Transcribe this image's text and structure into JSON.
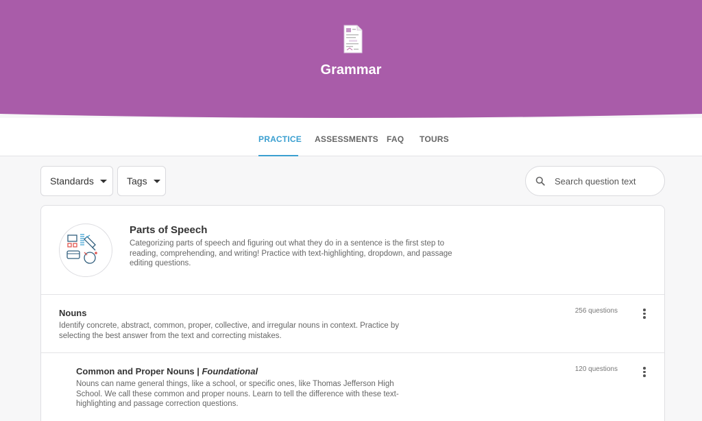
{
  "colors": {
    "hero_bg": "#a95ca9",
    "accent": "#3a9fd0"
  },
  "hero": {
    "icon": "grammar-document-icon",
    "title": "Grammar"
  },
  "tabs": [
    {
      "label": "PRACTICE",
      "active": true
    },
    {
      "label": "ASSESSMENTS",
      "active": false
    },
    {
      "label": "FAQ",
      "active": false
    },
    {
      "label": "TOURS",
      "active": false
    }
  ],
  "filters": {
    "standards_label": "Standards",
    "tags_label": "Tags"
  },
  "search": {
    "placeholder": "Search question text",
    "value": "",
    "icon": "search-icon"
  },
  "topic": {
    "icon": "parts-of-speech-illustration",
    "title": "Parts of Speech",
    "description": "Categorizing parts of speech and figuring out what they do in a sentence is the first step to reading, comprehending, and writing! Practice with text-highlighting, dropdown, and passage editing questions."
  },
  "skills": [
    {
      "title": "Nouns",
      "level": "",
      "description": "Identify concrete, abstract, common, proper, collective, and irregular nouns in context. Practice by selecting the best answer from the text and correcting mistakes.",
      "count": "256 questions"
    },
    {
      "title": "Common and Proper Nouns | ",
      "level": "Foundational",
      "description": "Nouns can name general things, like a school, or specific ones, like Thomas Jefferson High School. We call these common and proper nouns. Learn to tell the difference with these text-highlighting and passage correction questions.",
      "count": "120 questions"
    }
  ]
}
